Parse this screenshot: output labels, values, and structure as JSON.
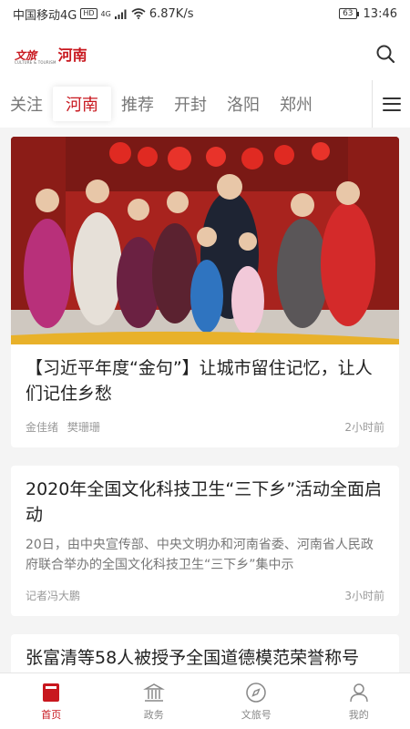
{
  "status_bar": {
    "carrier": "中国移动4G",
    "hd": "HD",
    "network": "4G",
    "speed": "6.87K/s",
    "battery": "63",
    "time": "13:46"
  },
  "header": {
    "logo_small": "文旅",
    "logo_small_en": "CULTURE & TOURISM",
    "logo_main": "河南",
    "search_icon": "search-icon"
  },
  "tabs": [
    {
      "label": "关注"
    },
    {
      "label": "河南",
      "active": true
    },
    {
      "label": "推荐"
    },
    {
      "label": "开封"
    },
    {
      "label": "洛阳"
    },
    {
      "label": "郑州"
    }
  ],
  "articles": [
    {
      "title": "【习近平年度“金句”】让城市留住记忆，让人们记住乡愁",
      "authors": [
        "金佳绪",
        "樊珊珊"
      ],
      "time": "2小时前",
      "has_image": true
    },
    {
      "title": "2020年全国文化科技卫生“三下乡”活动全面启动",
      "summary": "20日，由中央宣传部、中央文明办和河南省委、河南省人民政府联合举办的全国文化科技卫生“三下乡”集中示",
      "authors": [
        "记者冯大鹏"
      ],
      "time": "3小时前"
    },
    {
      "title": "张富清等58人被授予全国道德模范荣誉称号"
    }
  ],
  "bottom_nav": [
    {
      "label": "首页",
      "icon": "home-icon",
      "active": true
    },
    {
      "label": "政务",
      "icon": "government-building-icon"
    },
    {
      "label": "文旅号",
      "icon": "compass-icon"
    },
    {
      "label": "我的",
      "icon": "user-icon"
    }
  ],
  "colors": {
    "accent": "#c8171e",
    "text": "#222222",
    "muted": "#999999"
  }
}
